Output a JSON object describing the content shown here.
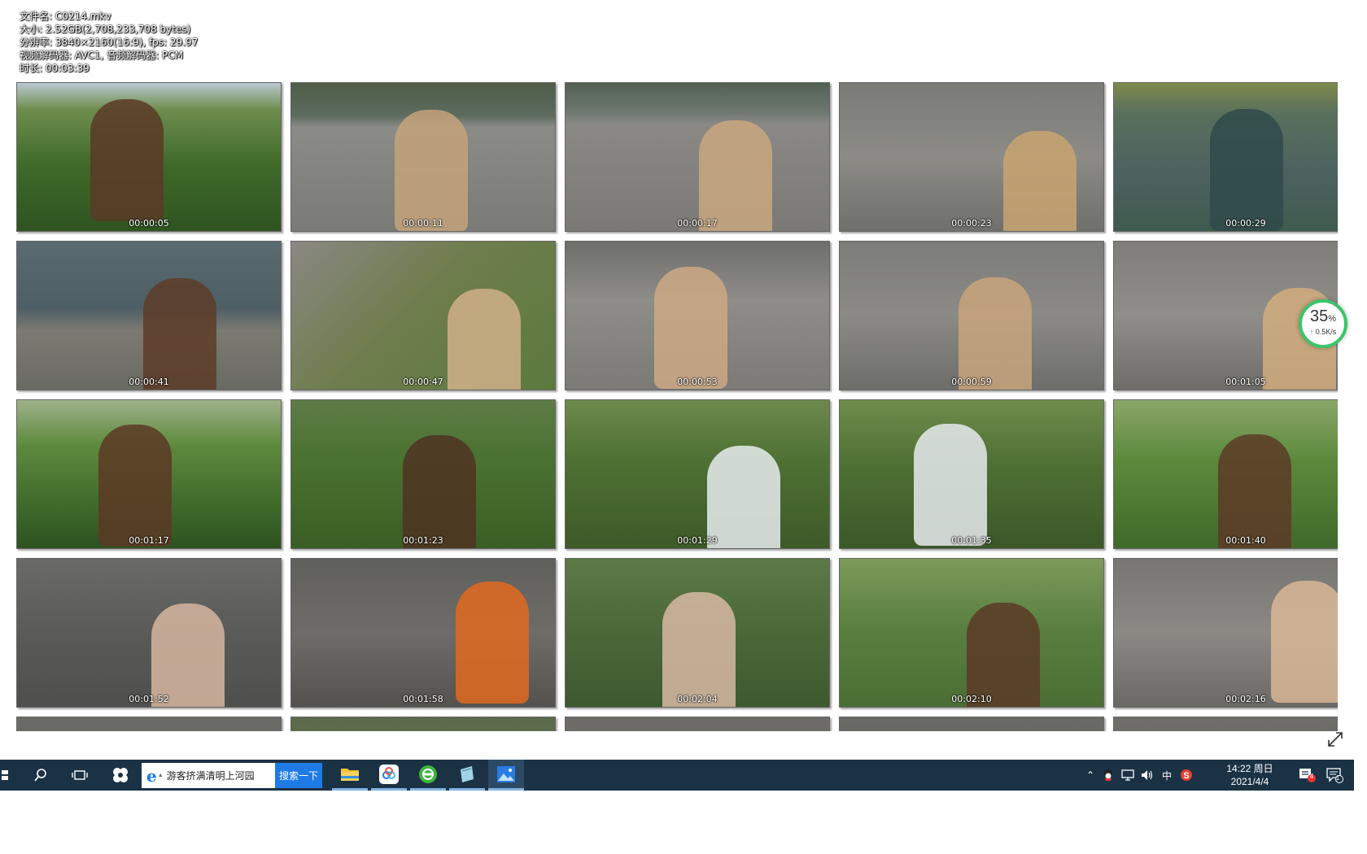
{
  "file_info": {
    "name": "文件名: C0214.mkv",
    "size": "大小: 2.52GB(2,708,233,708 bytes)",
    "resolution": "分辨率: 3840×2160(16:9), fps: 29.97",
    "codecs": "视频解码器: AVC1, 音频解码器: PCM",
    "duration": "时长: 00:03:39"
  },
  "thumbnails": [
    {
      "ts": "00:00:05",
      "bg": "linear-gradient(180deg,#b9c8cf 0%,#6e8d4d 18%,#3f6a2a 55%,#2f5420 100%)",
      "fig": "#5b3a26"
    },
    {
      "ts": "00:00:11",
      "bg": "linear-gradient(180deg,#4f5d4a 0%,#5d6b5e 22%,#8b8b87 30%,#7a7a76 100%)",
      "fig": "#c4a37b"
    },
    {
      "ts": "00:00:17",
      "bg": "linear-gradient(180deg,#536155 0%,#6a756c 18%,#8a8985 28%,#7a7976 100%)",
      "fig": "#c9a77e"
    },
    {
      "ts": "00:00:23",
      "bg": "linear-gradient(180deg,#7a7b77 0%,#8c8b86 50%,#6f706c 100%)",
      "fig": "#c8a471"
    },
    {
      "ts": "00:00:29",
      "bg": "linear-gradient(180deg,#7d8a4a 0%,#59705c 20%,#4c6260 60%,#3f5a4e 100%)",
      "fig": "#2f4a4a"
    },
    {
      "ts": "00:00:41",
      "bg": "linear-gradient(180deg,#596a70 0%,#4e5e65 45%,#7b7a72 60%,#6a6a64 100%)",
      "fig": "#5d3c28"
    },
    {
      "ts": "00:00:47",
      "bg": "linear-gradient(135deg,#8a8884 0%,#6f7d4d 45%,#5c7a3e 100%)",
      "fig": "#d0b08a"
    },
    {
      "ts": "00:00:53",
      "bg": "linear-gradient(180deg,#6e6e6b 0%,#8e8d89 40%,#7b7a77 100%)",
      "fig": "#cda985"
    },
    {
      "ts": "00:00:59",
      "bg": "linear-gradient(180deg,#7c7c79 0%,#8b8a86 50%,#6d6d6a 100%)",
      "fig": "#c9a57b"
    },
    {
      "ts": "00:01:05",
      "bg": "linear-gradient(180deg,#7f7e7a 0%,#8f8e8a 50%,#6e6d6a 100%)",
      "fig": "#d2ad7e"
    },
    {
      "ts": "00:01:17",
      "bg": "linear-gradient(180deg,#9fb28a 0%,#5e8a3e 30%,#3f6b2b 70%,#2e5220 100%)",
      "fig": "#5a3a25"
    },
    {
      "ts": "00:01:23",
      "bg": "linear-gradient(180deg,#5d7c46 0%,#4a7230 40%,#3a5e24 100%)",
      "fig": "#4f3322"
    },
    {
      "ts": "00:01:29",
      "bg": "linear-gradient(180deg,#6d8a4c 0%,#4e7134 40%,#3d5a28 100%)",
      "fig": "#e8ecef"
    },
    {
      "ts": "00:01:35",
      "bg": "linear-gradient(180deg,#6f8c4b 0%,#4d6f33 45%,#3b5828 100%)",
      "fig": "#e6eaee"
    },
    {
      "ts": "00:01:40",
      "bg": "linear-gradient(180deg,#8aa66a 0%,#5c8a3c 40%,#3f6a2a 100%)",
      "fig": "#5c3b27"
    },
    {
      "ts": "00:01:52",
      "bg": "linear-gradient(180deg,#6a6a68 0%,#5a5b58 50%,#4f504d 100%)",
      "fig": "#d6b6a0"
    },
    {
      "ts": "00:01:58",
      "bg": "linear-gradient(180deg,#5f5f5c 0%,#6e6c68 50%,#54524f 100%)",
      "fig": "#e06a20"
    },
    {
      "ts": "00:02:04",
      "bg": "linear-gradient(180deg,#5c7a48 0%,#4a6838 50%,#3c5a2e 100%)",
      "fig": "#d8b9a3"
    },
    {
      "ts": "00:02:10",
      "bg": "linear-gradient(180deg,#7d9a5a 0%,#5a8040 45%,#4a6e34 100%)",
      "fig": "#5a3a26"
    },
    {
      "ts": "00:02:16",
      "bg": "linear-gradient(180deg,#777672 0%,#8a8984 50%,#6a6966 100%)",
      "fig": "#d9b796"
    },
    {
      "ts": "",
      "bg": "linear-gradient(180deg,#6b6b68 0%,#5d5c59 100%)",
      "fig": "#5d3c28"
    },
    {
      "ts": "",
      "bg": "linear-gradient(180deg,#5b6a4a 0%,#6e7b55 100%)",
      "fig": "#5d3c28"
    },
    {
      "ts": "",
      "bg": "linear-gradient(180deg,#6e6d6a 0%,#5c5b58 100%)",
      "fig": "#5d3c28"
    },
    {
      "ts": "",
      "bg": "linear-gradient(180deg,#6a6a67 0%,#595956 100%)",
      "fig": "#5d3c28"
    },
    {
      "ts": "",
      "bg": "linear-gradient(180deg,#6f6e6b 0%,#5e5d5a 100%)",
      "fig": "#5d3c28"
    }
  ],
  "speed_widget": {
    "percent": "35",
    "unit": "%",
    "rate": "0.5K/s",
    "color": "#3cc46a"
  },
  "taskbar": {
    "search_text": "游客挤满清明上河园",
    "search_button": "搜索一下",
    "ime": "中",
    "time": "14:22 周日",
    "date": "2021/4/4",
    "notif_badge": "4",
    "action_badge": "1"
  }
}
